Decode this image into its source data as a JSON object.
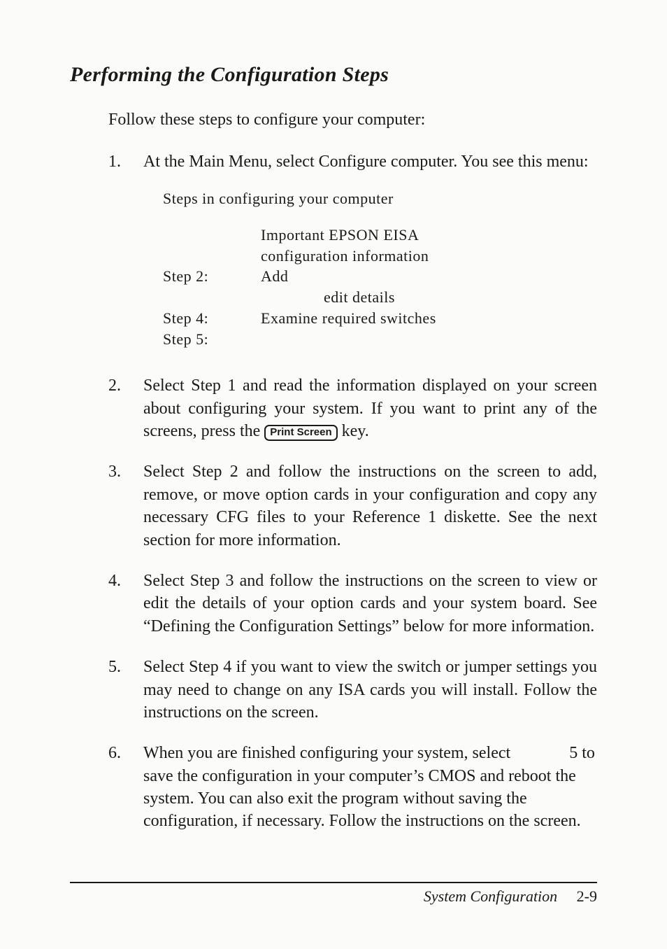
{
  "heading": "Performing the Configuration Steps",
  "intro": "Follow these steps to configure your computer:",
  "items": [
    {
      "num": "1.",
      "lead": "At the Main Menu, select Configure computer. You see this menu:",
      "menu": {
        "title": "Steps in configuring your computer",
        "rows": [
          {
            "label": "",
            "text": "Important EPSON EISA"
          },
          {
            "label": "",
            "text": "configuration information"
          },
          {
            "label": "Step 2:",
            "text": "Add"
          },
          {
            "label": "",
            "text": "    edit details"
          },
          {
            "label": "Step 4:",
            "text": "Examine required switches"
          },
          {
            "label": "Step 5:",
            "text": ""
          }
        ]
      }
    },
    {
      "num": "2.",
      "pre": "Select Step 1 and read the information displayed on your screen about configuring your system. If you want to print any of the screens, press the ",
      "key": "Print Screen",
      "post": " key."
    },
    {
      "num": "3.",
      "text": "Select Step 2 and follow the instructions on the screen to add, remove, or move option cards in your configuration and copy any necessary CFG files to your Reference 1 diskette. See the next section for more information."
    },
    {
      "num": "4.",
      "text": "Select Step 3 and follow the instructions on the screen to view or edit the details of your option cards and your system board. See “Defining the Configuration Settings” below for more information."
    },
    {
      "num": "5.",
      "text": "Select Step 4 if you want to view the switch or jumper settings you may need to change on any ISA cards you will install. Follow the instructions on the screen."
    },
    {
      "num": "6.",
      "text": "When you are finished configuring your system, select     5 to save the configuration in your computer’s CMOS and reboot the system. You can also exit the program without saving the configuration, if necessary. Follow the instructions on the screen."
    }
  ],
  "footer": {
    "label": "System Configuration",
    "page": "2-9"
  }
}
